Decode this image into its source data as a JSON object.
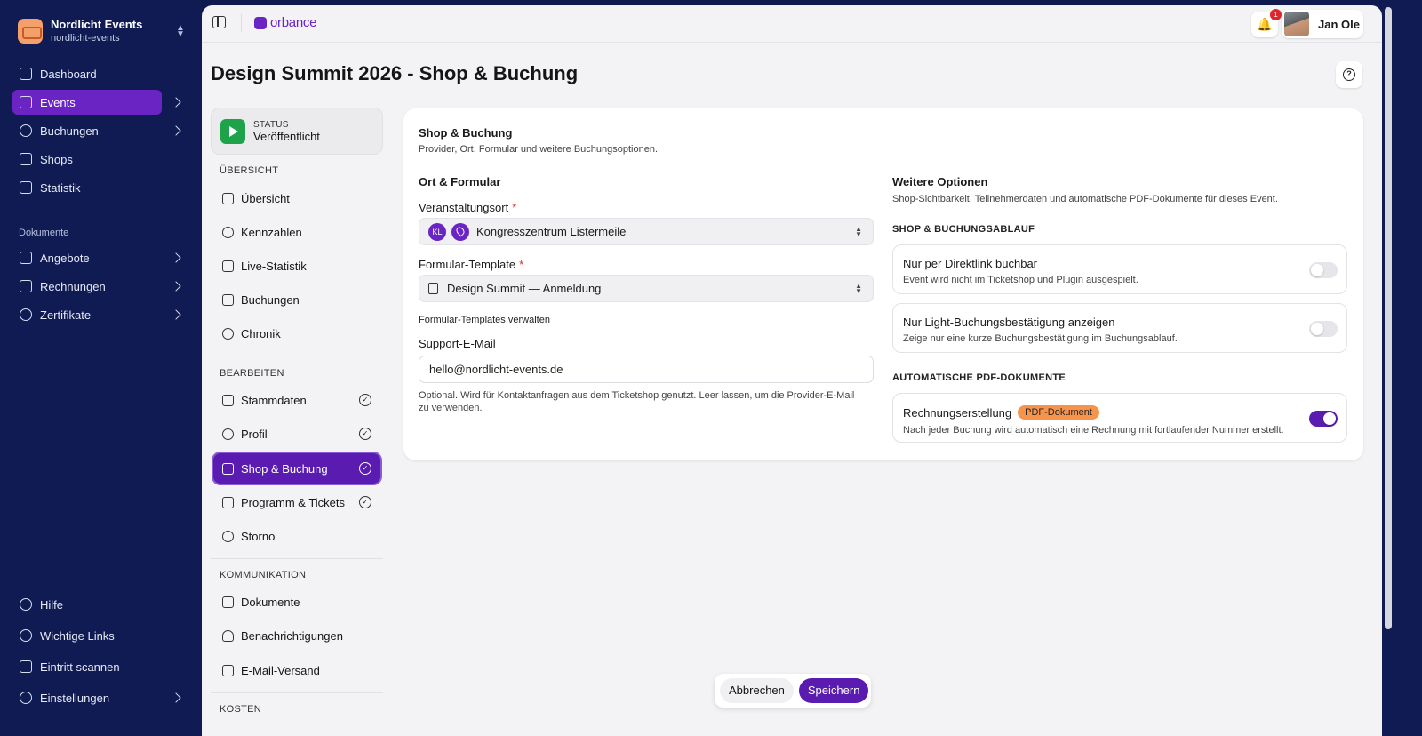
{
  "org": {
    "name": "Nordlicht Events",
    "slug": "nordlicht-events"
  },
  "sidebar": {
    "items": [
      {
        "label": "Dashboard",
        "icon": "home-icon"
      },
      {
        "label": "Events",
        "icon": "calendar-icon"
      },
      {
        "label": "Buchungen",
        "icon": "users-icon"
      },
      {
        "label": "Shops",
        "icon": "store-icon"
      },
      {
        "label": "Statistik",
        "icon": "bar-chart-icon"
      }
    ],
    "section_documents": "Dokumente",
    "doc_items": [
      {
        "label": "Angebote",
        "icon": "file-icon"
      },
      {
        "label": "Rechnungen",
        "icon": "receipt-icon"
      },
      {
        "label": "Zertifikate",
        "icon": "award-icon"
      }
    ],
    "bottom_items": [
      {
        "label": "Hilfe",
        "icon": "help-icon"
      },
      {
        "label": "Wichtige Links",
        "icon": "link-icon"
      },
      {
        "label": "Eintritt scannen",
        "icon": "scan-icon"
      },
      {
        "label": "Einstellungen",
        "icon": "settings-icon"
      }
    ]
  },
  "topbar": {
    "brand": "orbance",
    "notifications": "1",
    "user_name": "Jan Ole"
  },
  "page": {
    "title": "Design Summit 2026 - Shop & Buchung"
  },
  "status": {
    "label": "STATUS",
    "value": "Veröffentlicht"
  },
  "subnav": {
    "sections": {
      "overview": "ÜBERSICHT",
      "edit": "BEARBEITEN",
      "communication": "KOMMUNIKATION",
      "costs": "KOSTEN"
    },
    "overview": [
      "Übersicht",
      "Kennzahlen",
      "Live-Statistik",
      "Buchungen",
      "Chronik"
    ],
    "edit": [
      "Stammdaten",
      "Profil",
      "Shop & Buchung",
      "Programm & Tickets",
      "Storno"
    ],
    "communication": [
      "Dokumente",
      "Benachrichtigungen",
      "E-Mail-Versand"
    ]
  },
  "card": {
    "title": "Shop & Buchung",
    "subtitle": "Provider, Ort, Formular und weitere Buchungsoptionen.",
    "left": {
      "title": "Ort & Formular",
      "venue_label": "Veranstaltungsort",
      "venue_initials": "KL",
      "venue_value": "Kongresszentrum Listermeile",
      "template_label": "Formular-Template",
      "template_value": "Design Summit — Anmeldung",
      "manage_link": "Formular-Templates verwalten",
      "email_label": "Support-E-Mail",
      "email_value": "hello@nordlicht-events.de",
      "email_hint": "Optional. Wird für Kontaktanfragen aus dem Ticketshop genutzt. Leer lassen, um die Provider-E-Mail zu verwenden."
    },
    "right": {
      "title": "Weitere Optionen",
      "description": "Shop-Sichtbarkeit, Teilnehmerdaten und automatische PDF-Dokumente für dieses Event.",
      "section_shop": "SHOP & BUCHUNGSABLAUF",
      "section_pdf": "AUTOMATISCHE PDF-DOKUMENTE",
      "options": [
        {
          "title": "Nur per Direktlink buchbar",
          "text": "Event wird nicht im Ticketshop und Plugin ausgespielt.",
          "enabled": false
        },
        {
          "title": "Nur Light-Buchungsbestätigung anzeigen",
          "text": "Zeige nur eine kurze Buchungsbestätigung im Buchungsablauf.",
          "enabled": false
        },
        {
          "title": "Rechnungserstellung",
          "badge": "PDF-Dokument",
          "text": "Nach jeder Buchung wird automatisch eine Rechnung mit fortlaufender Nummer erstellt.",
          "enabled": true
        }
      ]
    }
  },
  "footer": {
    "cancel": "Abbrechen",
    "save": "Speichern"
  },
  "colors": {
    "accent": "#5a1bb0",
    "sidebar_bg": "#0f1b52",
    "status_green": "#1fa34a",
    "badge_orange": "#f7944c",
    "notification_red": "#e0262b"
  }
}
